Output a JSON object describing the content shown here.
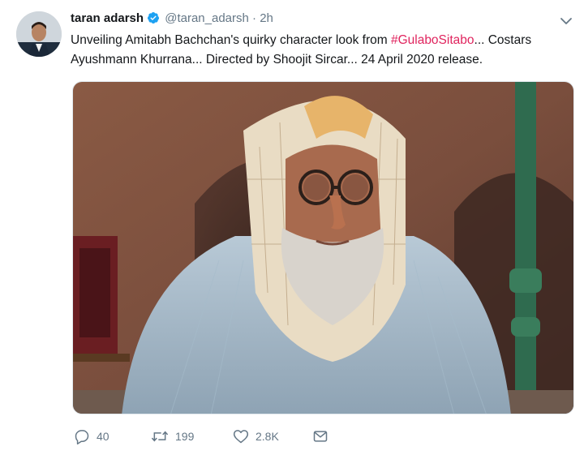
{
  "tweet": {
    "display_name": "taran adarsh",
    "handle": "@taran_adarsh",
    "separator": "·",
    "time": "2h",
    "text_part1": "Unveiling Amitabh Bachchan's quirky character look from ",
    "hashtag": "#GulaboSitabo",
    "text_part2": "... Costars Ayushmann Khurrana... Directed by Shoojit Sircar... 24 April 2020 release."
  },
  "actions": {
    "replies": "40",
    "retweets": "199",
    "likes": "2.8K"
  },
  "colors": {
    "verified": "#1da1f2",
    "hashtag": "#e0245e",
    "secondary_text": "#657786"
  },
  "icons": [
    "verified-badge-icon",
    "chevron-down-icon",
    "reply-icon",
    "retweet-icon",
    "like-icon",
    "message-icon"
  ]
}
